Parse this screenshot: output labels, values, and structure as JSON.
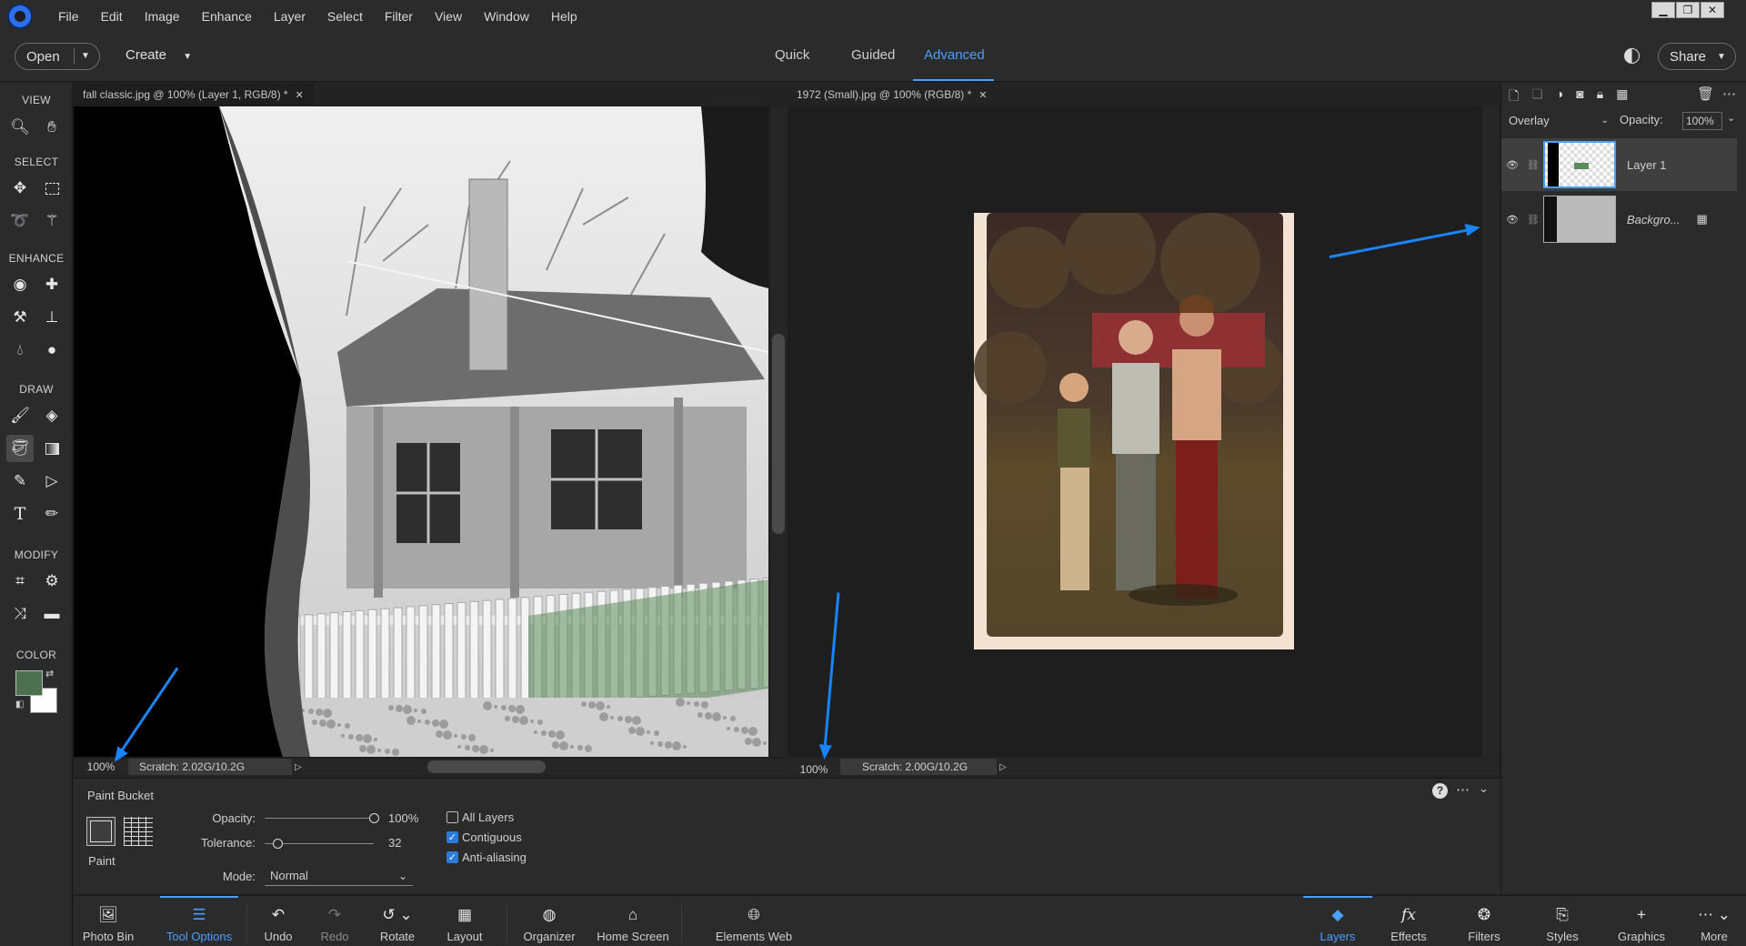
{
  "menu": [
    "File",
    "Edit",
    "Image",
    "Enhance",
    "Layer",
    "Select",
    "Filter",
    "View",
    "Window",
    "Help"
  ],
  "window_controls": {
    "minimize": "▁",
    "restore": "❐",
    "close": "✕"
  },
  "modebar": {
    "open_label": "Open",
    "create_label": "Create",
    "tabs": [
      "Quick",
      "Guided",
      "Advanced"
    ],
    "active_tab": "Advanced",
    "share_label": "Share"
  },
  "toolbar": {
    "sections": [
      "VIEW",
      "SELECT",
      "ENHANCE",
      "DRAW",
      "MODIFY",
      "COLOR"
    ],
    "foreground_color": "#4c7050",
    "background_color": "#ffffff"
  },
  "documents": [
    {
      "tab_title": "fall classic.jpg @ 100% (Layer 1, RGB/8) *",
      "zoom": "100%",
      "scratch": "Scratch: 2.02G/10.2G"
    },
    {
      "tab_title": "1972 (Small).jpg @ 100% (RGB/8) *",
      "zoom": "100%",
      "scratch": "Scratch: 2.00G/10.2G"
    }
  ],
  "layers_panel": {
    "blend_mode": "Overlay",
    "opacity_label": "Opacity:",
    "opacity_value": "100%",
    "layers": [
      {
        "name": "Layer 1",
        "selected": true
      },
      {
        "name": "Backgro...",
        "selected": false
      }
    ]
  },
  "tool_options": {
    "tool_name": "Paint Bucket",
    "paint_label": "Paint",
    "opacity_label": "Opacity:",
    "opacity_value": "100%",
    "opacity_level": 1.0,
    "tolerance_label": "Tolerance:",
    "tolerance_value": "32",
    "tolerance_level": 0.12,
    "mode_label": "Mode:",
    "mode_value": "Normal",
    "all_layers_label": "All Layers",
    "all_layers_checked": false,
    "contiguous_label": "Contiguous",
    "contiguous_checked": true,
    "antialiasing_label": "Anti-aliasing",
    "antialiasing_checked": true
  },
  "bottom_bar": {
    "left": [
      "Photo Bin",
      "Tool Options",
      "Undo",
      "Redo",
      "Rotate",
      "Layout",
      "Organizer",
      "Home Screen",
      "Elements Web"
    ],
    "right": [
      "Layers",
      "Effects",
      "Filters",
      "Styles",
      "Graphics",
      "More"
    ],
    "active_left": "Tool Options",
    "active_right": "Layers"
  },
  "accent_color": "#4a9fff"
}
